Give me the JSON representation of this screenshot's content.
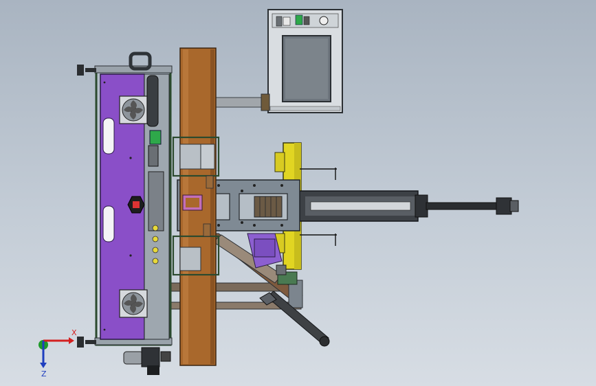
{
  "triad": {
    "x_label": "X",
    "z_label": "Z",
    "x_color": "#d42020",
    "y_color": "#1e9a2a",
    "z_color": "#1f3fbf"
  },
  "colors": {
    "background_top": "#a9b4c1",
    "background_bottom": "#d7dde4",
    "enclosure_panel": "#8a4fc8",
    "wooden_beam": "#a9682c",
    "frame_metal": "#7f8a94",
    "yellow_plate": "#e1d522",
    "control_box": "#d9dde1",
    "screen": "#6d757d",
    "cylinder_rod": "#a1a6ab"
  },
  "icons": [
    "fan-icon",
    "warning-hexagon-icon",
    "screen-icon",
    "cylinder-icon"
  ]
}
